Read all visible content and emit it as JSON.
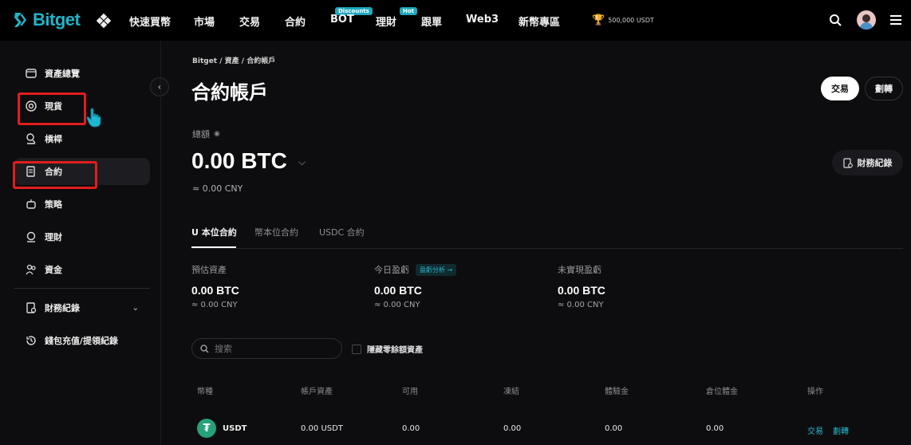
{
  "brand": {
    "name": "Bitget"
  },
  "nav": {
    "items": [
      {
        "label": "快速買幣"
      },
      {
        "label": "市場"
      },
      {
        "label": "交易"
      },
      {
        "label": "合約"
      },
      {
        "label": "BOT",
        "badge": "Discounts"
      },
      {
        "label": "理財"
      },
      {
        "label": "跟單",
        "badge": "Hot"
      },
      {
        "label": "Web3"
      },
      {
        "label": "新幣專區"
      }
    ],
    "prize": "500,000 USDT"
  },
  "sidebar": {
    "items": [
      {
        "label": "資產總覽",
        "icon": "wallet-icon"
      },
      {
        "label": "現貨",
        "icon": "target-icon"
      },
      {
        "label": "槓桿",
        "icon": "leverage-icon"
      },
      {
        "label": "合約",
        "icon": "contract-icon"
      },
      {
        "label": "策略",
        "icon": "robot-icon"
      },
      {
        "label": "理財",
        "icon": "finance-icon"
      },
      {
        "label": "資金",
        "icon": "users-icon"
      },
      {
        "label": "財務紀錄",
        "icon": "records-icon"
      },
      {
        "label": "錢包充值/提領紀錄",
        "icon": "history-icon"
      }
    ]
  },
  "breadcrumb": "Bitget / 資產 / 合約帳戶",
  "page": {
    "title": "合約帳戶",
    "trade_button": "交易",
    "transfer_button": "劃轉",
    "records_button": "財務紀錄"
  },
  "total": {
    "label": "總額",
    "value": "0.00 BTC",
    "cny": "≈ 0.00 CNY"
  },
  "tabs": [
    {
      "label": "U 本位合約"
    },
    {
      "label": "幣本位合約"
    },
    {
      "label": "USDC 合約"
    }
  ],
  "stats": [
    {
      "label": "預估資產",
      "value": "0.00 BTC",
      "cny": "≈ 0.00 CNY"
    },
    {
      "label": "今日盈虧",
      "badge": "盈虧分析 →",
      "value": "0.00 BTC",
      "cny": "≈ 0.00 CNY"
    },
    {
      "label": "未實現盈虧",
      "value": "0.00 BTC",
      "cny": "≈ 0.00 CNY"
    }
  ],
  "search": {
    "placeholder": "搜索"
  },
  "hide_zero_label": "隱藏零餘額資產",
  "table": {
    "headers": [
      "幣種",
      "帳戶資產",
      "可用",
      "凍結",
      "體驗金",
      "倉位體金",
      "操作"
    ],
    "rows": [
      {
        "coin": "USDT",
        "account": "0.00 USDT",
        "available": "0.00",
        "frozen": "0.00",
        "bonus": "0.00",
        "position_bonus": "0.00",
        "action_trade": "交易",
        "action_transfer": "劃轉"
      }
    ]
  },
  "colors": {
    "accent": "#22b3c8",
    "highlight": "#e21d1d",
    "usdt": "#26a17b"
  }
}
